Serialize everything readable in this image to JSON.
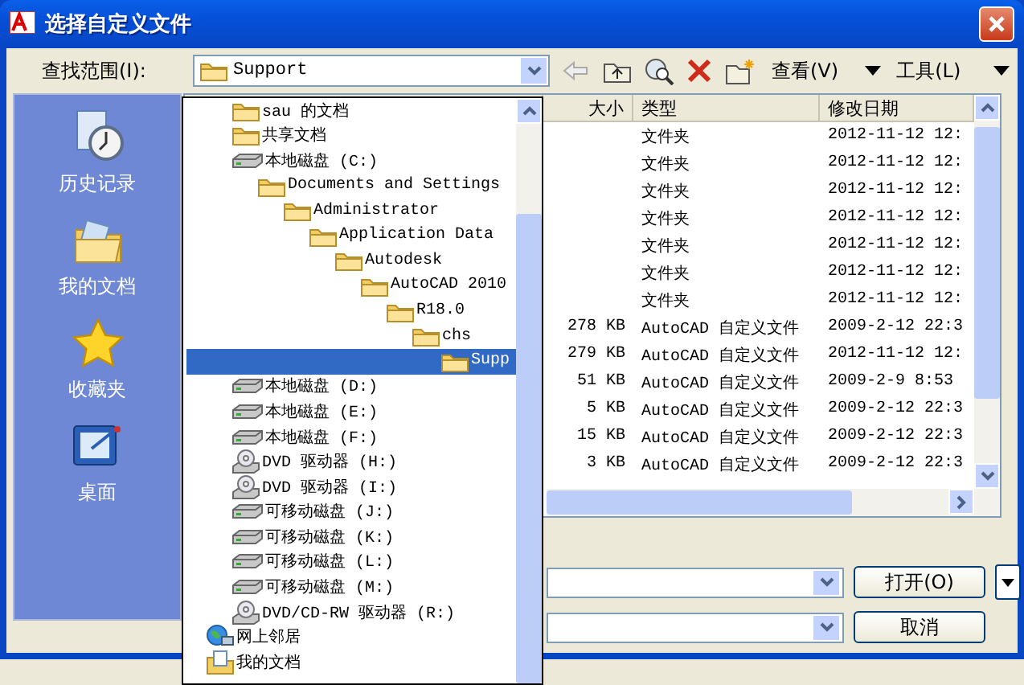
{
  "window": {
    "title": "选择自定义文件"
  },
  "toolbar": {
    "look_in_label": "查找范围(I):",
    "look_in_value": "Support",
    "view_menu": "查看(V)",
    "tools_menu": "工具(L)"
  },
  "places": [
    {
      "kind": "history",
      "label": "历史记录"
    },
    {
      "kind": "documents",
      "label": "我的文档"
    },
    {
      "kind": "favorites",
      "label": "收藏夹"
    },
    {
      "kind": "desktop",
      "label": "桌面"
    }
  ],
  "file_list": {
    "columns": [
      "大小",
      "类型",
      "修改日期"
    ],
    "rows": [
      {
        "type": "文件夹",
        "modified": "2012-11-12 12:"
      },
      {
        "type": "文件夹",
        "modified": "2012-11-12 12:"
      },
      {
        "type": "文件夹",
        "modified": "2012-11-12 12:"
      },
      {
        "type": "文件夹",
        "modified": "2012-11-12 12:"
      },
      {
        "type": "文件夹",
        "modified": "2012-11-12 12:"
      },
      {
        "type": "文件夹",
        "modified": "2012-11-12 12:"
      },
      {
        "type": "文件夹",
        "modified": "2012-11-12 12:"
      },
      {
        "size": "278 KB",
        "type": "AutoCAD 自定义文件",
        "modified": "2009-2-12 22:3"
      },
      {
        "size": "279 KB",
        "type": "AutoCAD 自定义文件",
        "modified": "2012-11-12 12:"
      },
      {
        "size": "51 KB",
        "type": "AutoCAD 自定义文件",
        "modified": "2009-2-9 8:53"
      },
      {
        "size": "5 KB",
        "type": "AutoCAD 自定义文件",
        "modified": "2009-2-12 22:3"
      },
      {
        "size": "15 KB",
        "type": "AutoCAD 自定义文件",
        "modified": "2009-2-12 22:3"
      },
      {
        "size": "3 KB",
        "type": "AutoCAD 自定义文件",
        "modified": "2009-2-12 22:3"
      }
    ]
  },
  "dropdown": {
    "items": [
      {
        "kind": "folder",
        "label": "sau 的文档",
        "selected": false
      },
      {
        "kind": "folder",
        "label": "共享文档",
        "selected": false
      },
      {
        "kind": "disk",
        "label": "本地磁盘 (C:)",
        "selected": false,
        "children": [
          {
            "kind": "folder",
            "label": "Documents and Settings",
            "selected": false,
            "children": [
              {
                "kind": "folder",
                "label": "Administrator",
                "selected": false,
                "children": [
                  {
                    "kind": "folder",
                    "label": "Application Data",
                    "selected": false,
                    "children": [
                      {
                        "kind": "folder",
                        "label": "Autodesk",
                        "selected": false,
                        "children": [
                          {
                            "kind": "folder",
                            "label": "AutoCAD 2010",
                            "selected": false,
                            "children": [
                              {
                                "kind": "folder",
                                "label": "R18.0",
                                "selected": false,
                                "children": [
                                  {
                                    "kind": "folder",
                                    "label": "chs",
                                    "selected": false,
                                    "children": [
                                      {
                                        "kind": "folder",
                                        "label": "Supp",
                                        "selected": true
                                      }
                                    ]
                                  }
                                ]
                              }
                            ]
                          }
                        ]
                      }
                    ]
                  }
                ]
              }
            ]
          }
        ]
      },
      {
        "kind": "disk",
        "label": "本地磁盘 (D:)",
        "selected": false
      },
      {
        "kind": "disk",
        "label": "本地磁盘 (E:)",
        "selected": false
      },
      {
        "kind": "disk",
        "label": "本地磁盘 (F:)",
        "selected": false
      },
      {
        "kind": "dvd",
        "label": "DVD 驱动器 (H:)",
        "selected": false
      },
      {
        "kind": "dvd",
        "label": "DVD 驱动器 (I:)",
        "selected": false
      },
      {
        "kind": "disk",
        "label": "可移动磁盘 (J:)",
        "selected": false
      },
      {
        "kind": "disk",
        "label": "可移动磁盘 (K:)",
        "selected": false
      },
      {
        "kind": "disk",
        "label": "可移动磁盘 (L:)",
        "selected": false
      },
      {
        "kind": "disk",
        "label": "可移动磁盘 (M:)",
        "selected": false
      },
      {
        "kind": "dvd",
        "label": "DVD/CD-RW 驱动器 (R:)",
        "selected": false
      },
      {
        "kind": "network",
        "label": "网上邻居",
        "selected": false,
        "root": true
      },
      {
        "kind": "mydocs",
        "label": "我的文档",
        "selected": false,
        "root": true
      }
    ]
  },
  "bottom": {
    "open_button": "打开(O)",
    "cancel_button": "取消"
  }
}
